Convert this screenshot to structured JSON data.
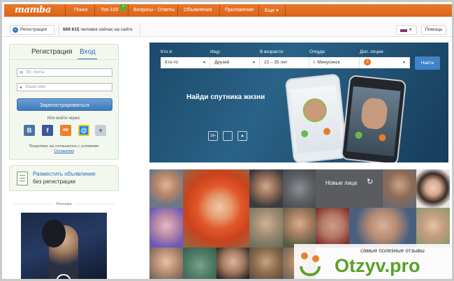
{
  "nav": {
    "logo": "mamba",
    "items": [
      "Поиск",
      "Топ-100",
      "Вопросы - Ответы",
      "Объявления",
      "Приложения",
      "Еще"
    ],
    "more_caret": "▾",
    "badge": "+"
  },
  "secbar": {
    "register_label": "Регистрация",
    "online_count": "669 615",
    "online_text": "человек сейчас на сайте",
    "help_label": "Помощь",
    "lang_caret": "▾"
  },
  "reg": {
    "tab_register": "Регистрация",
    "tab_login": "Вход",
    "email_placeholder": "Эл. почта",
    "name_placeholder": "Ваше имя",
    "submit": "Зарегистрироваться",
    "or_login_via": "Или войти через:",
    "social": [
      {
        "name": "vk",
        "glyph": "В",
        "color": "#4a76a8"
      },
      {
        "name": "facebook",
        "glyph": "f",
        "color": "#3b5998"
      },
      {
        "name": "odnoklassniki",
        "glyph": "ок",
        "color": "#ed812b"
      },
      {
        "name": "mailru",
        "glyph": "@",
        "color": "#168de2"
      },
      {
        "name": "more",
        "glyph": "▾",
        "color": "#a9b4c0"
      }
    ],
    "terms_prefix": "Продолжая, вы соглашаетесь с условиями",
    "terms_link": "Соглашения"
  },
  "ad": {
    "title": "Разместить объявление",
    "subtitle": "без регистрации",
    "reklama": "Реклама"
  },
  "search": {
    "fields": [
      {
        "label": "Кто я:",
        "value": "Кто-то"
      },
      {
        "label": "Ищу:",
        "value": "Друзей"
      },
      {
        "label": "В возрасте:",
        "value": "22 – 35 лет"
      },
      {
        "label": "Откуда:",
        "value": "г. Минусинск"
      },
      {
        "label": "Доп. опции:",
        "value": "2"
      }
    ],
    "button": "Найти"
  },
  "banner": {
    "slogan": "Найди спутника жизни",
    "age_badge": "18+",
    "apple_glyph": "",
    "android_glyph": "▲"
  },
  "grid": {
    "new_faces_label": "Новые лица",
    "refresh_glyph": "↻"
  },
  "watermark": {
    "caption": "самые полезные отзывы",
    "brand": "Otzyv.pro"
  },
  "colors": {
    "nav_orange": "#e26f23",
    "accent_blue": "#3f79bb",
    "link_blue": "#2a6ab7",
    "panel_green": "#f3f8ef",
    "brand_green": "#5aa02c"
  }
}
